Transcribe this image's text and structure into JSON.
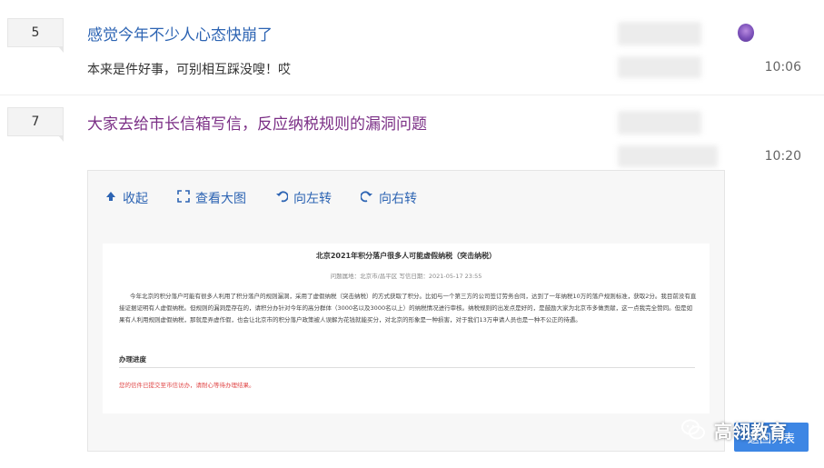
{
  "posts": [
    {
      "count": "5",
      "title": "感觉今年不少人心态快崩了",
      "snippet": "本来是件好事，可别相互踩没嗖！哎",
      "time": "10:06"
    },
    {
      "count": "7",
      "title": "大家去给市长信箱写信，反应纳税规则的漏洞问题",
      "time": "10:20"
    }
  ],
  "viewer": {
    "toolbar": {
      "collapse": "收起",
      "view_large": "查看大图",
      "rotate_left": "向左转",
      "rotate_right": "向右转"
    },
    "document": {
      "title": "北京2021年积分落户很多人可能虚假纳税（突击纳税）",
      "meta": "问题属地：北京市/昌平区      写信日期：2021-05-17 23:55",
      "body": "今年北京的积分落户可能有很多人利用了积分落户的规则漏洞，采用了虚假纳税（突击纳税）的方式获取了积分。比如与一个第三方的公司签订劳务合同，达到了一年纳税10万的落户规则标准，获取2分。我目前没有直接证据证明有人虚假纳税。但规则的漏洞是存在的，请积分办针对今年的高分群体（3000名以及3000名以上）的纳税情况进行审核。纳税规则的出发点是好的，是鼓励大家为北京市多做贡献，这一点我完全赞同。但是如果有人利用规则虚假纳税，那就是弄虚作假，也会让北京市的积分落户政策被人误解为花钱就能买分，对北京的形象是一种损害，对于我们13万申请人员也是一种不公正的待遇。",
      "progress_label": "办理进度",
      "status_note": "您的信件已提交至市信访办，请耐心等待办理结果。"
    }
  },
  "buttons": {
    "blue_button": "返回列表"
  },
  "watermark": {
    "text": "高翎教育"
  },
  "colors": {
    "link": "#2d64b3",
    "visited": "#7b2f86",
    "accent": "#3d86e4"
  }
}
